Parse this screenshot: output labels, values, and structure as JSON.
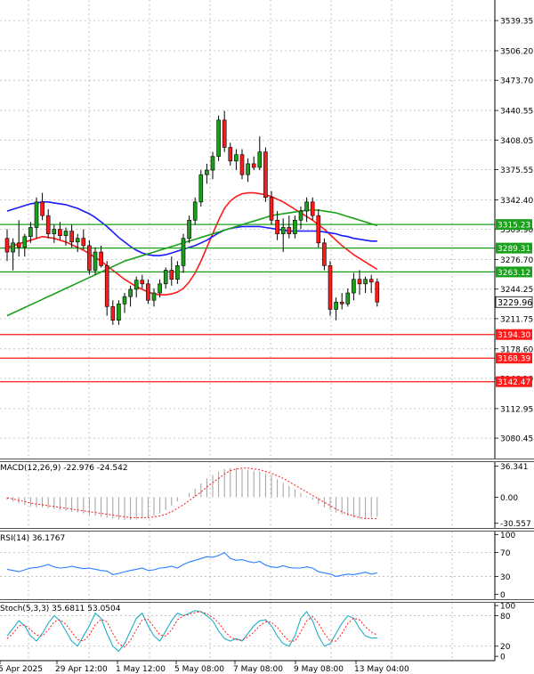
{
  "chart_data": [
    {
      "type": "candlestick",
      "price_axis": {
        "ticks": [
          "3539.35",
          "3506.20",
          "3473.70",
          "3440.55",
          "3408.05",
          "3375.55",
          "3342.40",
          "3309.90",
          "3276.70",
          "3244.25",
          "3211.75",
          "3178.60",
          "3146.10",
          "3112.95",
          "3080.45"
        ],
        "range": [
          3060,
          3560
        ]
      },
      "time_axis": {
        "ticks": [
          "5 Apr 2025",
          "29 Apr 12:00",
          "1 May 12:00",
          "5 May 08:00",
          "7 May 08:00",
          "9 May 08:00",
          "13 May 04:00"
        ]
      },
      "last_price": "3229.96",
      "levels": [
        {
          "label": "3315.23",
          "value": 3315.23,
          "color": "#1aa01a"
        },
        {
          "label": "3289.31",
          "value": 3289.31,
          "color": "#1aa01a"
        },
        {
          "label": "3263.12",
          "value": 3263.12,
          "color": "#1aa01a"
        },
        {
          "label": "3194.30",
          "value": 3194.3,
          "color": "#ff1a1a"
        },
        {
          "label": "3168.39",
          "value": 3168.39,
          "color": "#ff1a1a"
        },
        {
          "label": "3142.47",
          "value": 3142.47,
          "color": "#ff1a1a"
        }
      ],
      "candles": [
        [
          3300,
          3310,
          3275,
          3285
        ],
        [
          3285,
          3300,
          3265,
          3295
        ],
        [
          3295,
          3320,
          3280,
          3290
        ],
        [
          3290,
          3305,
          3280,
          3302
        ],
        [
          3302,
          3318,
          3295,
          3312
        ],
        [
          3312,
          3345,
          3300,
          3340
        ],
        [
          3340,
          3350,
          3320,
          3325
        ],
        [
          3325,
          3332,
          3300,
          3305
        ],
        [
          3305,
          3315,
          3295,
          3310
        ],
        [
          3310,
          3318,
          3298,
          3303
        ],
        [
          3303,
          3312,
          3292,
          3308
        ],
        [
          3308,
          3315,
          3290,
          3296
        ],
        [
          3296,
          3305,
          3285,
          3300
        ],
        [
          3300,
          3310,
          3288,
          3292
        ],
        [
          3292,
          3298,
          3260,
          3265
        ],
        [
          3265,
          3290,
          3260,
          3285
        ],
        [
          3285,
          3292,
          3268,
          3270
        ],
        [
          3270,
          3275,
          3215,
          3225
        ],
        [
          3225,
          3232,
          3205,
          3210
        ],
        [
          3210,
          3232,
          3205,
          3228
        ],
        [
          3228,
          3240,
          3218,
          3236
        ],
        [
          3236,
          3248,
          3225,
          3244
        ],
        [
          3244,
          3258,
          3235,
          3254
        ],
        [
          3254,
          3260,
          3245,
          3250
        ],
        [
          3250,
          3255,
          3228,
          3232
        ],
        [
          3232,
          3245,
          3225,
          3240
        ],
        [
          3240,
          3255,
          3235,
          3250
        ],
        [
          3250,
          3268,
          3245,
          3265
        ],
        [
          3265,
          3280,
          3248,
          3255
        ],
        [
          3255,
          3275,
          3250,
          3270
        ],
        [
          3270,
          3305,
          3262,
          3300
        ],
        [
          3300,
          3325,
          3295,
          3320
        ],
        [
          3320,
          3345,
          3315,
          3340
        ],
        [
          3340,
          3375,
          3335,
          3370
        ],
        [
          3370,
          3382,
          3360,
          3375
        ],
        [
          3375,
          3395,
          3365,
          3390
        ],
        [
          3390,
          3435,
          3385,
          3430
        ],
        [
          3430,
          3440,
          3395,
          3400
        ],
        [
          3400,
          3405,
          3380,
          3385
        ],
        [
          3385,
          3398,
          3375,
          3392
        ],
        [
          3392,
          3398,
          3365,
          3370
        ],
        [
          3370,
          3388,
          3362,
          3382
        ],
        [
          3382,
          3390,
          3375,
          3378
        ],
        [
          3378,
          3412,
          3375,
          3395
        ],
        [
          3395,
          3400,
          3340,
          3345
        ],
        [
          3345,
          3352,
          3315,
          3320
        ],
        [
          3320,
          3330,
          3298,
          3305
        ],
        [
          3305,
          3322,
          3285,
          3312
        ],
        [
          3312,
          3325,
          3300,
          3305
        ],
        [
          3305,
          3325,
          3300,
          3320
        ],
        [
          3320,
          3335,
          3310,
          3330
        ],
        [
          3330,
          3345,
          3318,
          3340
        ],
        [
          3340,
          3345,
          3320,
          3325
        ],
        [
          3325,
          3332,
          3290,
          3295
        ],
        [
          3295,
          3300,
          3265,
          3270
        ],
        [
          3270,
          3275,
          3215,
          3222
        ],
        [
          3222,
          3235,
          3210,
          3230
        ],
        [
          3230,
          3240,
          3222,
          3228
        ],
        [
          3228,
          3245,
          3225,
          3240
        ],
        [
          3240,
          3262,
          3232,
          3255
        ],
        [
          3255,
          3265,
          3238,
          3250
        ],
        [
          3250,
          3258,
          3240,
          3255
        ],
        [
          3255,
          3260,
          3240,
          3252
        ],
        [
          3252,
          3256,
          3225,
          3230
        ]
      ],
      "moving_averages": [
        {
          "color": "#ff1a1a",
          "values": [
            3290,
            3292,
            3294,
            3296,
            3298,
            3300,
            3302,
            3301,
            3300,
            3298,
            3296,
            3293,
            3290,
            3287,
            3283,
            3279,
            3275,
            3270,
            3265,
            3260,
            3255,
            3251,
            3247,
            3244,
            3241,
            3239,
            3238,
            3238,
            3239,
            3241,
            3245,
            3252,
            3262,
            3275,
            3290,
            3305,
            3320,
            3333,
            3341,
            3346,
            3349,
            3350,
            3350,
            3349,
            3348,
            3346,
            3343,
            3340,
            3336,
            3332,
            3328,
            3324,
            3320,
            3315,
            3310,
            3304,
            3298,
            3292,
            3287,
            3282,
            3278,
            3274,
            3270,
            3266
          ]
        },
        {
          "color": "#1a1aff",
          "values": [
            3330,
            3332,
            3334,
            3336,
            3338,
            3339,
            3340,
            3340,
            3339,
            3338,
            3337,
            3335,
            3333,
            3330,
            3327,
            3323,
            3318,
            3313,
            3307,
            3301,
            3296,
            3291,
            3287,
            3284,
            3282,
            3281,
            3281,
            3282,
            3284,
            3286,
            3288,
            3290,
            3292,
            3295,
            3298,
            3302,
            3306,
            3309,
            3311,
            3312,
            3313,
            3313,
            3313,
            3313,
            3312,
            3311,
            3310,
            3309,
            3308,
            3308,
            3308,
            3308,
            3308,
            3308,
            3307,
            3306,
            3305,
            3303,
            3302,
            3300,
            3299,
            3298,
            3297,
            3297
          ]
        },
        {
          "color": "#1aa01a",
          "values": [
            3215,
            3218,
            3221,
            3224,
            3227,
            3230,
            3233,
            3236,
            3239,
            3242,
            3245,
            3248,
            3251,
            3254,
            3257,
            3260,
            3263,
            3266,
            3269,
            3272,
            3275,
            3277,
            3279,
            3281,
            3283,
            3285,
            3287,
            3289,
            3291,
            3293,
            3295,
            3297,
            3299,
            3301,
            3303,
            3305,
            3307,
            3309,
            3311,
            3313,
            3315,
            3317,
            3319,
            3321,
            3323,
            3325,
            3326,
            3327,
            3328,
            3329,
            3330,
            3331,
            3331,
            3331,
            3330,
            3329,
            3328,
            3326,
            3324,
            3322,
            3320,
            3318,
            3316,
            3314
          ]
        }
      ],
      "macd": {
        "label": "MACD(12,26,9) -22.976 -24.542",
        "ticks": [
          "36.341",
          "0.00",
          "-30.557"
        ],
        "range": [
          -34,
          40
        ],
        "histogram": [
          -3,
          -5,
          -7,
          -9,
          -11,
          -12,
          -12,
          -13,
          -14,
          -15,
          -16,
          -17,
          -18,
          -19,
          -21,
          -22,
          -23,
          -24,
          -25,
          -26,
          -27,
          -27,
          -26,
          -25,
          -24,
          -22,
          -19,
          -15,
          -10,
          -5,
          0,
          5,
          10,
          16,
          22,
          26,
          30,
          33,
          34,
          34,
          33,
          32,
          31,
          30,
          28,
          25,
          21,
          17,
          13,
          9,
          5,
          1,
          -3,
          -8,
          -12,
          -15,
          -18,
          -20,
          -22,
          -24,
          -25,
          -25,
          -24,
          -23
        ],
        "signal": [
          -1,
          -2,
          -4,
          -5,
          -7,
          -8,
          -9,
          -10,
          -11,
          -12,
          -13,
          -14,
          -15,
          -16,
          -17,
          -18,
          -19,
          -20,
          -21,
          -22,
          -23,
          -24,
          -24,
          -24,
          -24,
          -23,
          -22,
          -20,
          -17,
          -13,
          -9,
          -4,
          1,
          6,
          12,
          17,
          22,
          27,
          31,
          33,
          34,
          34,
          33,
          32,
          30,
          28,
          25,
          22,
          18,
          14,
          10,
          6,
          2,
          -2,
          -6,
          -10,
          -14,
          -17,
          -20,
          -22,
          -24,
          -25,
          -25,
          -25
        ]
      },
      "rsi": {
        "label": "RSI(14) 36.1767",
        "ticks": [
          "100",
          "70",
          "30",
          "0"
        ],
        "range": [
          -5,
          102
        ],
        "values": [
          42,
          40,
          38,
          41,
          44,
          45,
          47,
          50,
          46,
          44,
          45,
          47,
          45,
          43,
          44,
          42,
          40,
          39,
          33,
          35,
          38,
          40,
          42,
          44,
          40,
          41,
          44,
          45,
          47,
          44,
          50,
          54,
          57,
          60,
          63,
          62,
          65,
          70,
          60,
          57,
          58,
          55,
          53,
          55,
          49,
          46,
          45,
          48,
          45,
          44,
          44,
          46,
          44,
          38,
          36,
          34,
          30,
          32,
          34,
          33,
          35,
          37,
          34,
          36
        ]
      },
      "stoch": {
        "label": "Stoch(5,3,3) 35.6811 53.0504",
        "ticks": [
          "100",
          "80",
          "20",
          "0"
        ],
        "range": [
          -5,
          102
        ],
        "k": [
          40,
          55,
          70,
          60,
          40,
          30,
          45,
          65,
          80,
          70,
          50,
          30,
          20,
          40,
          60,
          85,
          75,
          45,
          20,
          10,
          25,
          50,
          75,
          85,
          60,
          40,
          30,
          50,
          70,
          85,
          80,
          85,
          90,
          88,
          80,
          70,
          50,
          35,
          30,
          35,
          30,
          45,
          60,
          70,
          72,
          60,
          40,
          25,
          20,
          40,
          75,
          88,
          70,
          40,
          20,
          25,
          45,
          65,
          80,
          75,
          55,
          40,
          36,
          36
        ],
        "d": [
          35,
          45,
          60,
          62,
          52,
          42,
          40,
          52,
          68,
          72,
          63,
          48,
          33,
          30,
          42,
          62,
          73,
          68,
          45,
          25,
          18,
          32,
          52,
          72,
          73,
          58,
          42,
          40,
          52,
          72,
          80,
          83,
          86,
          88,
          84,
          77,
          66,
          50,
          38,
          33,
          32,
          38,
          48,
          60,
          68,
          67,
          57,
          42,
          30,
          30,
          48,
          70,
          78,
          65,
          45,
          30,
          30,
          45,
          65,
          75,
          72,
          58,
          48,
          42
        ]
      }
    }
  ]
}
